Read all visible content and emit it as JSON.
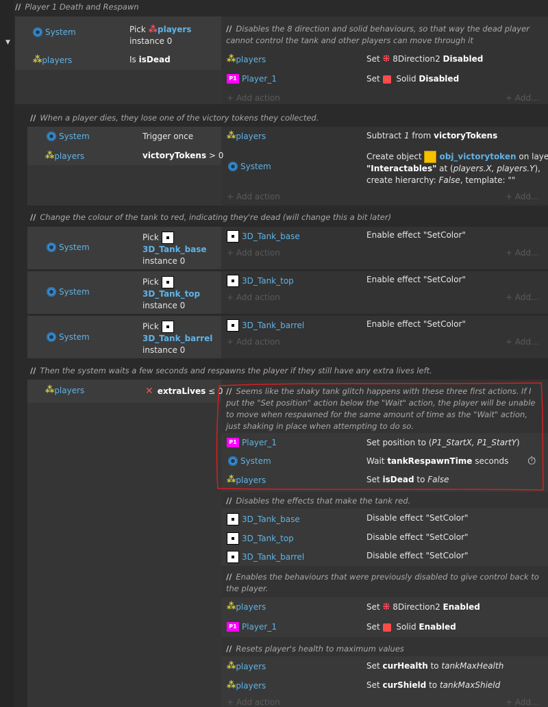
{
  "group": {
    "title": "Player 1 Death and Respawn"
  },
  "icons": {
    "system": "gear-icon",
    "players": "players-sprite-icon",
    "tank": "sprite-square-icon",
    "player1": "p1-sprite-icon",
    "solid": "solid-behavior-icon",
    "eight_dir": "8direction-behavior-icon",
    "token": "token-sprite-icon",
    "timer": "stopwatch-icon",
    "invert": "invert-x-icon",
    "collapse": "collapse-arrow-icon"
  },
  "colors": {
    "object": "#5fb3e6",
    "highlight": "#e02020",
    "p1": "#ff00ff"
  },
  "common": {
    "system": "System",
    "players": "players",
    "player_1": "Player_1",
    "add_action": "+ Add action",
    "add": "+ Add...",
    "pick": "Pick",
    "instance0": "instance 0",
    "trigger_once": "Trigger once"
  },
  "ev1": {
    "comment": "Disables the 8 direction and solid behaviours, so that way the dead player cannot control the tank and other players can move through it",
    "cond2_pre": "Is ",
    "cond2_b": "isDead",
    "act1_pre": "Set ",
    "act1_mid": " 8Direction2 ",
    "act1_b": "Disabled",
    "act2_pre": "Set ",
    "act2_mid": " Solid ",
    "act2_b": "Disabled"
  },
  "ev2": {
    "comment": "When a player dies, they lose one of the victory tokens they collected.",
    "cond2_b": "victoryTokens",
    "cond2_post": " > 0",
    "act1_a": "Subtract ",
    "act1_i": "1",
    "act1_b_pre": " from ",
    "act1_b": "victoryTokens",
    "act2_a": "Create object ",
    "act2_obj": "obj_victorytoken",
    "act2_b": " on layer",
    "act2_l2_b": "\"Interactables\"",
    "act2_l2_a": " at (",
    "act2_l2_i": "players.X, players.Y",
    "act2_l2_c": "),",
    "act2_l3_a": "create hierarchy: ",
    "act2_l3_i": "False",
    "act2_l3_b": ", template: \"\""
  },
  "ev3": {
    "comment": "Change the colour of the tank to red, indicating they're dead (will change this a bit later)",
    "sub": [
      {
        "obj": "3D_Tank_base",
        "act": "Enable effect \"SetColor\""
      },
      {
        "obj": "3D_Tank_top",
        "act": "Enable effect \"SetColor\""
      },
      {
        "obj": "3D_Tank_barrel",
        "act": "Enable effect \"SetColor\""
      }
    ]
  },
  "ev4": {
    "comment": "Then the system waits a few seconds and respawns the player if they still have any extra lives left.",
    "cond_b": "extraLives",
    "cond_post": " ≤ 0",
    "comment_a": "Seems like the shaky tank glitch happens with these three first actions. If I put the \"Set position\" action below the \"Wait\" action, the player will be unable to move when respawned for the same amount of time as the \"Wait\" action, just shaking in place when attempting to do so.",
    "a1": "Set position to (",
    "a1_i": "P1_StartX, P1_StartY",
    "a1_end": ")",
    "a2_pre": "Wait ",
    "a2_b": "tankRespawnTime",
    "a2_post": " seconds",
    "a3_pre": "Set ",
    "a3_b": "isDead",
    "a3_mid": " to ",
    "a3_i": "False",
    "comment_b": "Disables the effects that make the tank red.",
    "eff": [
      {
        "obj": "3D_Tank_base",
        "act": "Disable effect \"SetColor\""
      },
      {
        "obj": "3D_Tank_top",
        "act": "Disable effect \"SetColor\""
      },
      {
        "obj": "3D_Tank_barrel",
        "act": "Disable effect \"SetColor\""
      }
    ],
    "comment_c": "Enables the behaviours that were previously disabled to give control back to the player.",
    "b1_pre": "Set ",
    "b1_mid": " 8Direction2 ",
    "b1_b": "Enabled",
    "b2_pre": "Set ",
    "b2_mid": " Solid ",
    "b2_b": "Enabled",
    "comment_d": "Resets player's health to maximum values",
    "h1_pre": "Set ",
    "h1_b": "curHealth",
    "h1_mid": " to ",
    "h1_i": "tankMaxHealth",
    "h2_pre": "Set ",
    "h2_b": "curShield",
    "h2_mid": " to ",
    "h2_i": "tankMaxShield"
  }
}
